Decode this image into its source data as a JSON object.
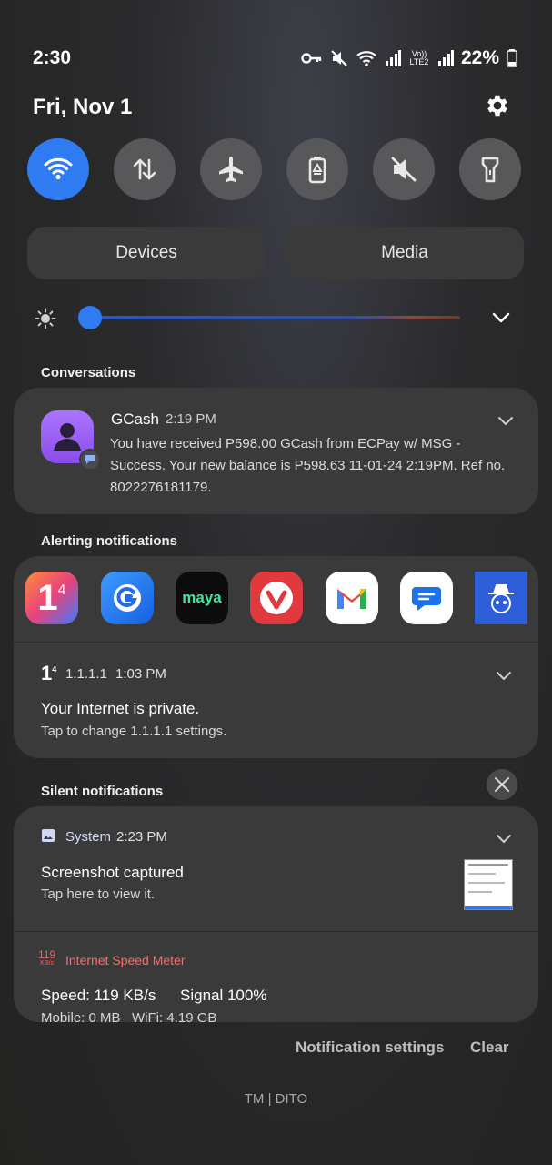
{
  "status": {
    "time": "2:30",
    "battery": "22%",
    "network": "Vo)) LTE2"
  },
  "header": {
    "date": "Fri, Nov 1"
  },
  "quick_settings": {
    "tiles": [
      {
        "name": "wifi",
        "active": true
      },
      {
        "name": "mobile-data",
        "active": false
      },
      {
        "name": "airplane-mode",
        "active": false
      },
      {
        "name": "power-saving",
        "active": false
      },
      {
        "name": "mute",
        "active": false
      },
      {
        "name": "flashlight",
        "active": false
      }
    ],
    "devices_label": "Devices",
    "media_label": "Media",
    "brightness_level": 0.03
  },
  "conversations": {
    "label": "Conversations",
    "item": {
      "app": "GCash",
      "time": "2:19 PM",
      "body": "You have received P598.00 GCash from ECPay w/ MSG - Success. Your new balance is P598.63 11-01-24 2:19PM. Ref no. 8022276181179."
    }
  },
  "alerting": {
    "label": "Alerting notifications",
    "apps": [
      "1.1.1.1",
      "GCash",
      "maya",
      "Vivaldi",
      "Gmail",
      "Messages",
      "Blocker"
    ],
    "maya_text": "maya",
    "item": {
      "app": "1.1.1.1",
      "time": "1:03 PM",
      "title": "Your Internet is private.",
      "subtitle": "Tap to change 1.1.1.1 settings."
    }
  },
  "silent": {
    "label": "Silent notifications",
    "system": {
      "app": "System",
      "time": "2:23 PM",
      "title": "Screenshot captured",
      "subtitle": "Tap here to view it."
    },
    "speed_meter": {
      "icon_value": "119",
      "icon_unit": "KB/s",
      "app": "Internet Speed Meter",
      "speed_line": "Speed: 119 KB/s",
      "signal_line": "Signal 100%",
      "usage_line": "Mobile: 0 MB   WiFi: 4.19 GB"
    }
  },
  "footer": {
    "settings_label": "Notification settings",
    "clear_label": "Clear",
    "carrier": "TM | DITO"
  },
  "colors": {
    "accent": "#2f7bf2",
    "card": "#3a3a3b",
    "speed_meter": "#ff5a5a"
  }
}
